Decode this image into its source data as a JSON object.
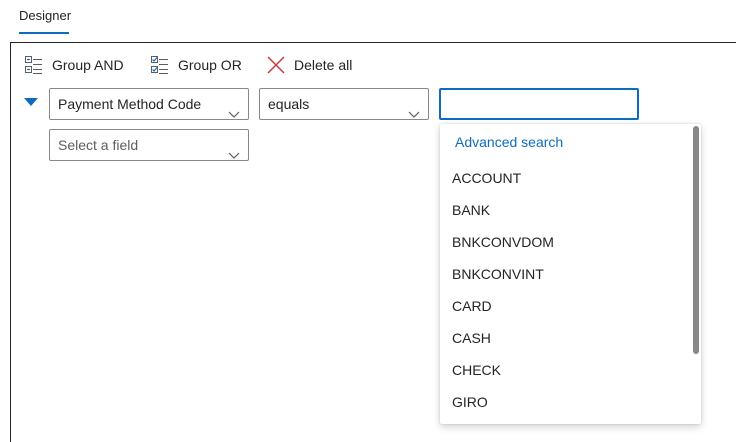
{
  "tabs": [
    {
      "label": "Designer"
    }
  ],
  "toolbar": {
    "group_and_label": "Group AND",
    "group_or_label": "Group OR",
    "delete_all_label": "Delete all"
  },
  "condition": {
    "field": "Payment Method Code",
    "operator": "equals",
    "value": "",
    "new_field_placeholder": "Select a field"
  },
  "dropdown": {
    "advanced_search_label": "Advanced search",
    "options": [
      "ACCOUNT",
      "BANK",
      "BNKCONVDOM",
      "BNKCONVINT",
      "CARD",
      "CASH",
      "CHECK",
      "GIRO"
    ]
  },
  "colors": {
    "accent": "#0f6cbd",
    "delete_icon": "#d13438",
    "border": "#8a8886"
  }
}
